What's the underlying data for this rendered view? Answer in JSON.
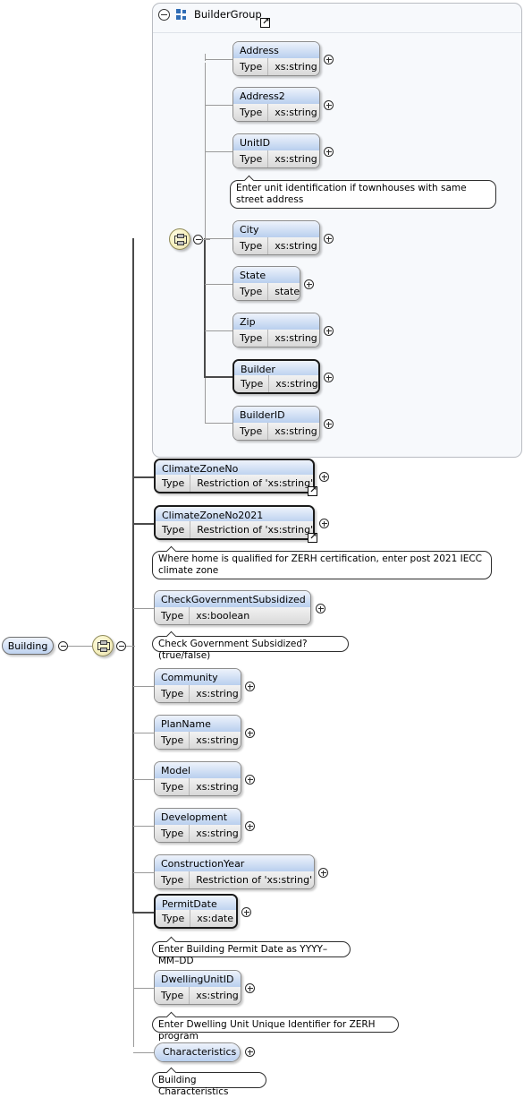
{
  "root": {
    "label": "Building",
    "collapse_icon": "minus-circle-icon"
  },
  "group": {
    "title": "BuilderGroup",
    "icon": "group-squares-icon",
    "collapse_icon": "minus-circle-icon",
    "link_badge": "goto-definition-icon",
    "children": [
      {
        "name": "Address",
        "type_label": "Type",
        "type_value": "xs:string",
        "required": false
      },
      {
        "name": "Address2",
        "type_label": "Type",
        "type_value": "xs:string",
        "required": false
      },
      {
        "name": "UnitID",
        "type_label": "Type",
        "type_value": "xs:string",
        "required": false
      },
      {
        "name": "City",
        "type_label": "Type",
        "type_value": "xs:string",
        "required": false
      },
      {
        "name": "State",
        "type_label": "Type",
        "type_value": "state",
        "required": false
      },
      {
        "name": "Zip",
        "type_label": "Type",
        "type_value": "xs:string",
        "required": false
      },
      {
        "name": "Builder",
        "type_label": "Type",
        "type_value": "xs:string",
        "required": true
      },
      {
        "name": "BuilderID",
        "type_label": "Type",
        "type_value": "xs:string",
        "required": false
      }
    ],
    "annotations": [
      {
        "text": "Enter unit identification if townhouses with same street address"
      }
    ]
  },
  "elements": [
    {
      "name": "ClimateZoneNo",
      "type_label": "Type",
      "type_value": "Restriction of 'xs:string'",
      "required": true,
      "link": true
    },
    {
      "name": "ClimateZoneNo2021",
      "type_label": "Type",
      "type_value": "Restriction of 'xs:string'",
      "required": true,
      "link": true
    },
    {
      "name": "CheckGovernmentSubsidized",
      "type_label": "Type",
      "type_value": "xs:boolean",
      "required": false,
      "link": false
    },
    {
      "name": "Community",
      "type_label": "Type",
      "type_value": "xs:string",
      "required": false,
      "link": false
    },
    {
      "name": "PlanName",
      "type_label": "Type",
      "type_value": "xs:string",
      "required": false,
      "link": false
    },
    {
      "name": "Model",
      "type_label": "Type",
      "type_value": "xs:string",
      "required": false,
      "link": false
    },
    {
      "name": "Development",
      "type_label": "Type",
      "type_value": "xs:string",
      "required": false,
      "link": false
    },
    {
      "name": "ConstructionYear",
      "type_label": "Type",
      "type_value": "Restriction of 'xs:string'",
      "required": false,
      "link": false
    },
    {
      "name": "PermitDate",
      "type_label": "Type",
      "type_value": "xs:date",
      "required": true,
      "link": false
    },
    {
      "name": "DwellingUnitID",
      "type_label": "Type",
      "type_value": "xs:string",
      "required": false,
      "link": false
    },
    {
      "name": "Characteristics",
      "type_label": "",
      "type_value": "",
      "required": false,
      "link": false
    }
  ],
  "annotations": [
    {
      "text": "Where home is qualified for ZERH certification, enter post 2021 IECC climate zone"
    },
    {
      "text": "Check Government Subsidized? (true/false)"
    },
    {
      "text": "Enter Building Permit Date as YYYY–MM–DD"
    },
    {
      "text": "Enter Dwelling Unit Unique Identifier for ZERH program"
    },
    {
      "text": "Building Characteristics"
    }
  ],
  "colors": {
    "element_header_accent": "#b9cfee",
    "group_panel_bg": "#f7f9fc",
    "required_border": "#1a1a1a",
    "optional_border": "#8d8d8d",
    "sequence_icon": "#f6f0bd",
    "group_icon": "#2f6cb5"
  }
}
